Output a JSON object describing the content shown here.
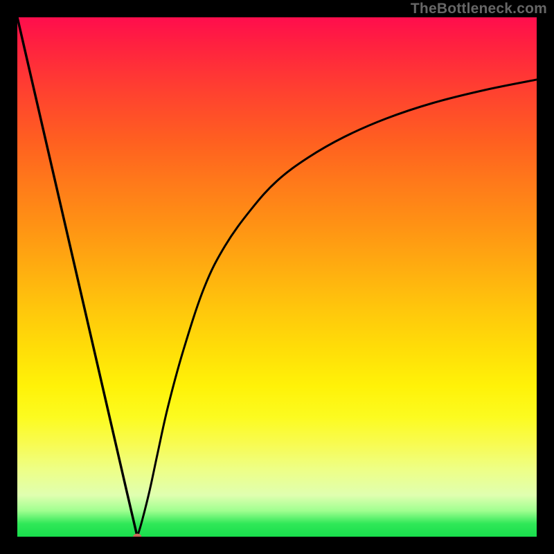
{
  "attribution": "TheBottleneck.com",
  "chart_data": {
    "type": "line",
    "title": "",
    "xlabel": "",
    "ylabel": "",
    "xlim": [
      0,
      100
    ],
    "ylim": [
      0,
      100
    ],
    "legend": false,
    "grid": false,
    "background": {
      "kind": "vertical-gradient",
      "stops": [
        {
          "pos": 0,
          "color": "#ff0d4d"
        },
        {
          "pos": 50,
          "color": "#ffb010"
        },
        {
          "pos": 75,
          "color": "#fff810"
        },
        {
          "pos": 100,
          "color": "#18dd4c"
        }
      ]
    },
    "series": [
      {
        "name": "left-branch",
        "stroke": "#000000",
        "x": [
          0,
          3,
          6,
          9,
          12,
          15,
          18,
          21,
          22.4,
          23.1
        ],
        "y": [
          100,
          87,
          74,
          61,
          48,
          35,
          22,
          9,
          3,
          0
        ]
      },
      {
        "name": "right-branch",
        "stroke": "#000000",
        "x": [
          23.1,
          24,
          25.5,
          27,
          29,
          32,
          36,
          40,
          45,
          50,
          56,
          63,
          71,
          80,
          90,
          100
        ],
        "y": [
          0,
          3,
          9,
          16,
          25,
          36,
          48,
          56,
          63,
          68.5,
          73,
          77,
          80.5,
          83.5,
          86,
          88
        ]
      }
    ],
    "vertex_marker": {
      "x": 23.1,
      "y": 0,
      "color": "#c96a5a",
      "rx": 0.8,
      "ry": 0.6
    },
    "frame_color": "#000000"
  }
}
